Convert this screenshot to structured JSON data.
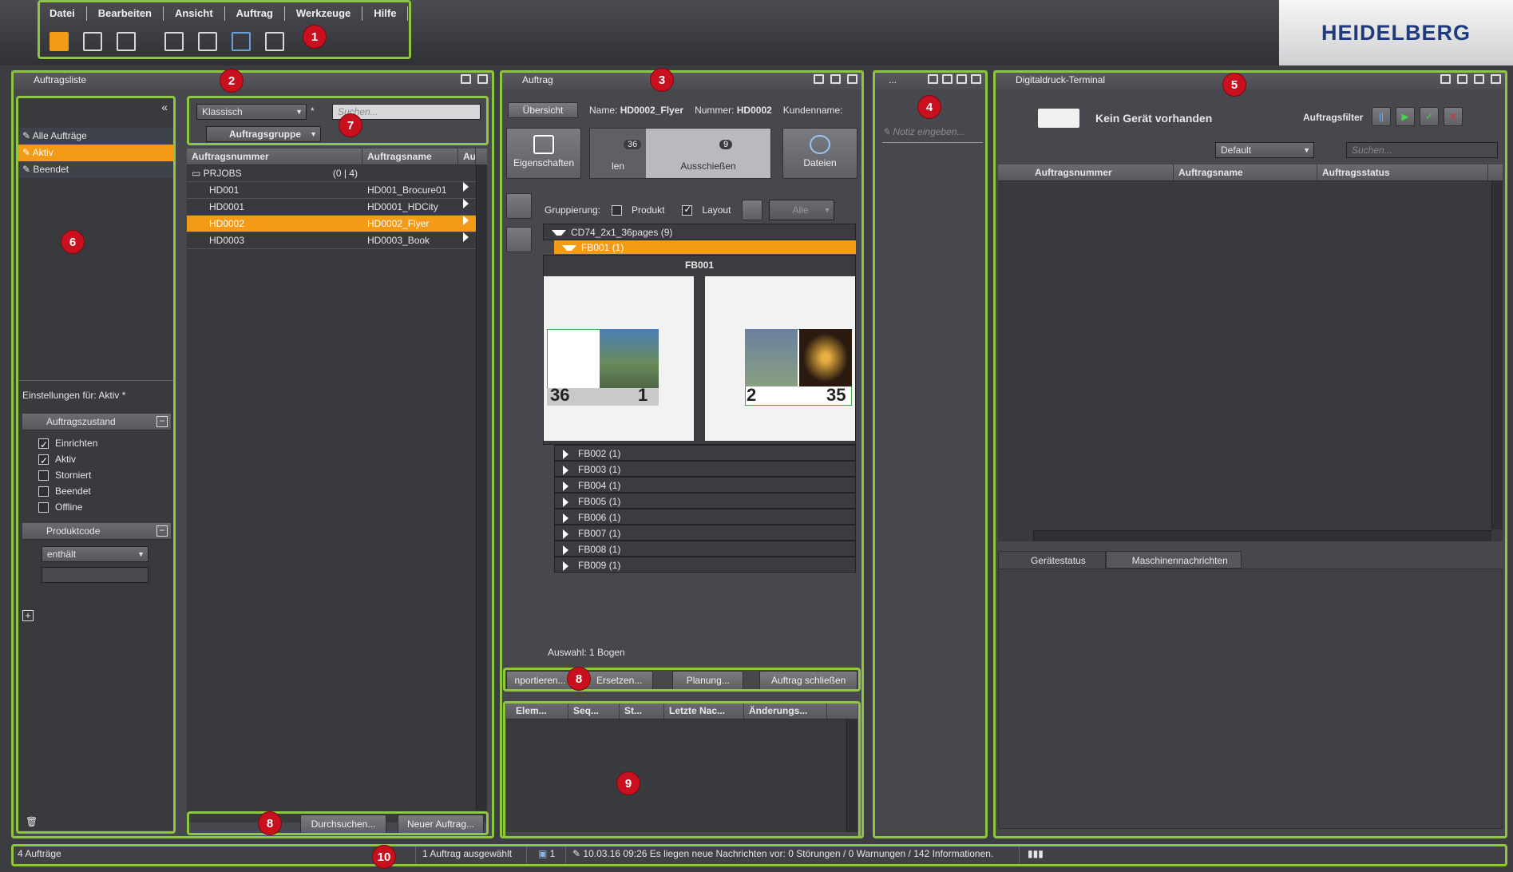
{
  "menu": [
    "Datei",
    "Bearbeiten",
    "Ansicht",
    "Auftrag",
    "Werkzeuge",
    "Hilfe"
  ],
  "brand": "HEIDELBERG",
  "badges": [
    "1",
    "2",
    "3",
    "4",
    "5",
    "6",
    "7",
    "8",
    "9",
    "8",
    "10"
  ],
  "auftragsliste": {
    "title": "Auftragsliste",
    "filters": [
      "Alle Aufträge",
      "Aktiv",
      "Beendet"
    ],
    "selected_filter": "Aktiv",
    "settings_label": "Einstellungen für: Aktiv *",
    "auftragszustand": {
      "title": "Auftragszustand",
      "items": [
        {
          "label": "Einrichten",
          "checked": true
        },
        {
          "label": "Aktiv",
          "checked": true
        },
        {
          "label": "Storniert",
          "checked": false
        },
        {
          "label": "Beendet",
          "checked": false
        },
        {
          "label": "Offline",
          "checked": false
        }
      ]
    },
    "produktcode": {
      "title": "Produktcode",
      "combo": "enthält"
    },
    "view_combo": "Klassisch",
    "asterisk": "*",
    "search_placeholder": "Suchen...",
    "group_label": "Auftragsgruppe",
    "columns": [
      "Auftragsnummer",
      "Auftragsname",
      "Au"
    ],
    "group_row": {
      "name": "PRJOBS",
      "count": "(0 | 4)"
    },
    "rows": [
      {
        "nr": "HD001",
        "name": "HD001_Brocure01"
      },
      {
        "nr": "HD0001",
        "name": "HD0001_HDCity"
      },
      {
        "nr": "HD0002",
        "name": "HD0002_Flyer",
        "selected": true
      },
      {
        "nr": "HD0003",
        "name": "HD0003_Book"
      }
    ],
    "btn_search": "Durchsuchen...",
    "btn_new": "Neuer Auftrag..."
  },
  "auftrag": {
    "title": "Auftrag",
    "tab": "Übersicht",
    "name_label": "Name:",
    "name_value": "HD0002_Flyer",
    "nummer_label": "Nummer:",
    "nummer_value": "HD0002",
    "kunde_label": "Kundenname:",
    "workflow": [
      {
        "label": "Eigenschaften"
      },
      {
        "label": "len",
        "count": "36"
      },
      {
        "label": "Ausschießen",
        "count": "9"
      },
      {
        "label": "Dateien"
      }
    ],
    "gruppierung": "Gruppierung:",
    "produkt": "Produkt",
    "layout": "Layout",
    "alle": "Alle",
    "tree_root": "CD74_2x1_36pages (9)",
    "tree_selected": "FB001 (1)",
    "preview_title": "FB001",
    "page_nums": [
      "36",
      "1",
      "2",
      "35"
    ],
    "tree_items": [
      "FB002 (1)",
      "FB003 (1)",
      "FB004 (1)",
      "FB005 (1)",
      "FB006 (1)",
      "FB007 (1)",
      "FB008 (1)",
      "FB009 (1)"
    ],
    "selection": "Auswahl:  1 Bogen",
    "buttons": [
      "nportieren...",
      "Ersetzen...",
      "Planung...",
      "Auftrag schließen"
    ],
    "lower_columns": [
      "Elem...",
      "Seq...",
      "St...",
      "Letzte Nac...",
      "Änderungs..."
    ]
  },
  "notes": {
    "title": "...",
    "placeholder": "Notiz eingeben..."
  },
  "terminal": {
    "title": "Digitaldruck-Terminal",
    "device": "Kein Gerät vorhanden",
    "filter_label": "Auftragsfilter",
    "combo": "Default",
    "search_placeholder": "Suchen...",
    "columns": [
      "Auftragsnummer",
      "Auftragsname",
      "Auftragsstatus"
    ],
    "tabs": [
      "Gerätestatus",
      "Maschinennachrichten"
    ]
  },
  "status": {
    "count": "4 Aufträge",
    "selected": "1 Auftrag ausgewählt",
    "num": "1",
    "message": "10.03.16 09:26  Es liegen neue Nachrichten vor: 0 Störungen / 0 Warnungen / 142 Informationen."
  },
  "colors": {
    "accent": "#f39a17",
    "highlight": "#8fc640",
    "badge": "#c8101e"
  }
}
